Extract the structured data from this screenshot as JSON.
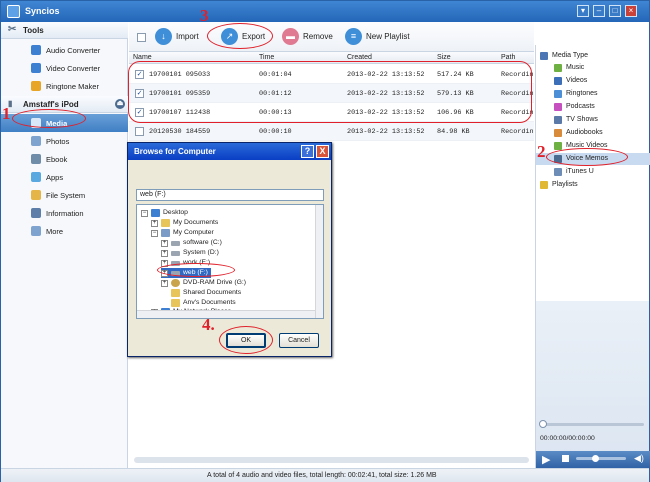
{
  "app": {
    "title": "Syncios"
  },
  "sidebar": {
    "tools_header": "Tools",
    "tools": [
      {
        "label": "Audio Converter",
        "icon": "audio-converter-icon",
        "color": "#3d7fd1"
      },
      {
        "label": "Video Converter",
        "icon": "video-converter-icon",
        "color": "#3d7fd1"
      },
      {
        "label": "Ringtone Maker",
        "icon": "ringtone-maker-icon",
        "color": "#e8a628"
      }
    ],
    "device_header": "Amstaff's iPod",
    "device_items": [
      {
        "label": "Media",
        "icon": "media-icon",
        "color": "#5d8fd0"
      },
      {
        "label": "Photos",
        "icon": "photos-icon",
        "color": "#7ea3cf"
      },
      {
        "label": "Ebook",
        "icon": "ebook-icon",
        "color": "#6f8ca8"
      },
      {
        "label": "Apps",
        "icon": "apps-icon",
        "color": "#5aa8e0"
      },
      {
        "label": "File System",
        "icon": "file-system-icon",
        "color": "#e5b548"
      },
      {
        "label": "Information",
        "icon": "information-icon",
        "color": "#5d7ea8"
      },
      {
        "label": "More",
        "icon": "more-icon",
        "color": "#7ea3cf"
      }
    ]
  },
  "toolbar": {
    "import_label": "Import",
    "export_label": "Export",
    "remove_label": "Remove",
    "new_playlist_label": "New Playlist"
  },
  "table": {
    "columns": [
      "Name",
      "Time",
      "Created",
      "Size",
      "Path"
    ],
    "rows": [
      {
        "checked": true,
        "name": "19700101 095033",
        "time": "00:01:04",
        "created": "2013-02-22 13:13:52",
        "size": "517.24 KB",
        "path": "Recordin"
      },
      {
        "checked": true,
        "name": "19700101 095359",
        "time": "00:01:12",
        "created": "2013-02-22 13:13:52",
        "size": "579.13 KB",
        "path": "Recordin"
      },
      {
        "checked": true,
        "name": "19700107 112438",
        "time": "00:00:13",
        "created": "2013-02-22 13:13:52",
        "size": "106.96 KB",
        "path": "Recordin"
      },
      {
        "checked": false,
        "name": "20120530 184559",
        "time": "00:00:10",
        "created": "2013-02-22 13:13:52",
        "size": "84.98 KB",
        "path": "Recordin"
      }
    ]
  },
  "media_panel": {
    "items": [
      {
        "label": "Media Type",
        "icon": "media-type-icon",
        "color": "#4c77b4"
      },
      {
        "label": "Music",
        "icon": "music-icon",
        "color": "#6fb043"
      },
      {
        "label": "Videos",
        "icon": "videos-icon",
        "color": "#3d6fb8"
      },
      {
        "label": "Ringtones",
        "icon": "ringtones-icon",
        "color": "#4c8fd6"
      },
      {
        "label": "Podcasts",
        "icon": "podcasts-icon",
        "color": "#c650c0"
      },
      {
        "label": "TV Shows",
        "icon": "tv-shows-icon",
        "color": "#5a78a8"
      },
      {
        "label": "Audiobooks",
        "icon": "audiobooks-icon",
        "color": "#d88b3b"
      },
      {
        "label": "Music Videos",
        "icon": "music-videos-icon",
        "color": "#6fb043"
      },
      {
        "label": "Voice Memos",
        "icon": "voice-memos-icon",
        "color": "#4a6a8f"
      },
      {
        "label": "iTunes U",
        "icon": "itunes-u-icon",
        "color": "#6d8db6"
      },
      {
        "label": "Playlists",
        "icon": "playlists-icon",
        "color": "#e0b833"
      }
    ]
  },
  "player": {
    "time": "00:00:00/00:00:00"
  },
  "status": {
    "text": "A total of 4 audio and video files, total length: 00:02:41, total size: 1.26 MB"
  },
  "dialog": {
    "title": "Browse for Computer",
    "help": "?",
    "close": "X",
    "path": "web (F:)",
    "tree": [
      {
        "label": "Desktop",
        "expander": "-",
        "color": "#3d7fd1"
      },
      {
        "label": "My Documents",
        "expander": "+",
        "color": "#e8c55a"
      },
      {
        "label": "My Computer",
        "expander": "-",
        "color": "#7a9bc6"
      },
      {
        "label": "software (C:)",
        "expander": "+",
        "color": "#9aa5b1"
      },
      {
        "label": "System (D:)",
        "expander": "+",
        "color": "#9aa5b1"
      },
      {
        "label": "work (E:)",
        "expander": "+",
        "color": "#9aa5b1"
      },
      {
        "label": "web (F:)",
        "expander": "+",
        "color": "#9aa5b1"
      },
      {
        "label": "DVD-RAM Drive (G:)",
        "expander": "+",
        "color": "#c9a44a"
      },
      {
        "label": "Shared Documents",
        "expander": "",
        "color": "#e8c55a"
      },
      {
        "label": "Anv's Documents",
        "expander": "",
        "color": "#e8c55a"
      },
      {
        "label": "My Network Places",
        "expander": "+",
        "color": "#3d7fd1"
      }
    ],
    "ok_label": "OK",
    "cancel_label": "Cancel"
  },
  "annotations": {
    "n1": "1",
    "n2": "2",
    "n3": "3",
    "n4": "4.",
    "color": "#e0212b"
  }
}
